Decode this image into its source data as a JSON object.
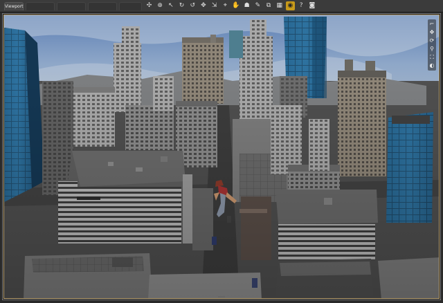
{
  "viewport_tabs": [
    {
      "label": "Viewport",
      "active": true
    },
    {
      "label": "",
      "active": false
    },
    {
      "label": "",
      "active": false
    },
    {
      "label": "",
      "active": false
    },
    {
      "label": "",
      "active": false
    }
  ],
  "toolbar": {
    "tools": [
      {
        "icon": "universal-tool-icon",
        "glyph": "✣"
      },
      {
        "icon": "move-target-icon",
        "glyph": "⊕"
      },
      {
        "icon": "select-arrow-icon",
        "glyph": "↖"
      },
      {
        "icon": "rotate-icon",
        "glyph": "↻"
      },
      {
        "icon": "twist-icon",
        "glyph": "↺"
      },
      {
        "icon": "translate-icon",
        "glyph": "✥"
      },
      {
        "icon": "scale-icon",
        "glyph": "⇲"
      },
      {
        "icon": "joint-editor-icon",
        "glyph": "⌖"
      },
      {
        "icon": "pose-hand-icon",
        "glyph": "✋"
      },
      {
        "icon": "node-weight-icon",
        "glyph": "☗"
      },
      {
        "icon": "brush-icon",
        "glyph": "✎"
      },
      {
        "icon": "geometry-editor-icon",
        "glyph": "⧉"
      },
      {
        "icon": "surface-selection-icon",
        "glyph": "▦"
      },
      {
        "icon": "spot-render-icon",
        "glyph": "◉",
        "selected": true
      },
      {
        "icon": "tooltip-query-icon",
        "glyph": "?"
      },
      {
        "icon": "camera-icon",
        "glyph": "◙"
      }
    ],
    "accent": "#c89a1a"
  },
  "viewport": {
    "frame_color": "#b8a070",
    "nav_tools": [
      {
        "icon": "view-menu-icon",
        "glyph": "⌐"
      },
      {
        "icon": "pan-icon",
        "glyph": "✥"
      },
      {
        "icon": "orbit-icon",
        "glyph": "⟳"
      },
      {
        "icon": "zoom-icon",
        "glyph": "⚲"
      },
      {
        "icon": "frame-icon",
        "glyph": "⛶"
      },
      {
        "icon": "camera-view-icon",
        "glyph": "◐"
      }
    ]
  }
}
